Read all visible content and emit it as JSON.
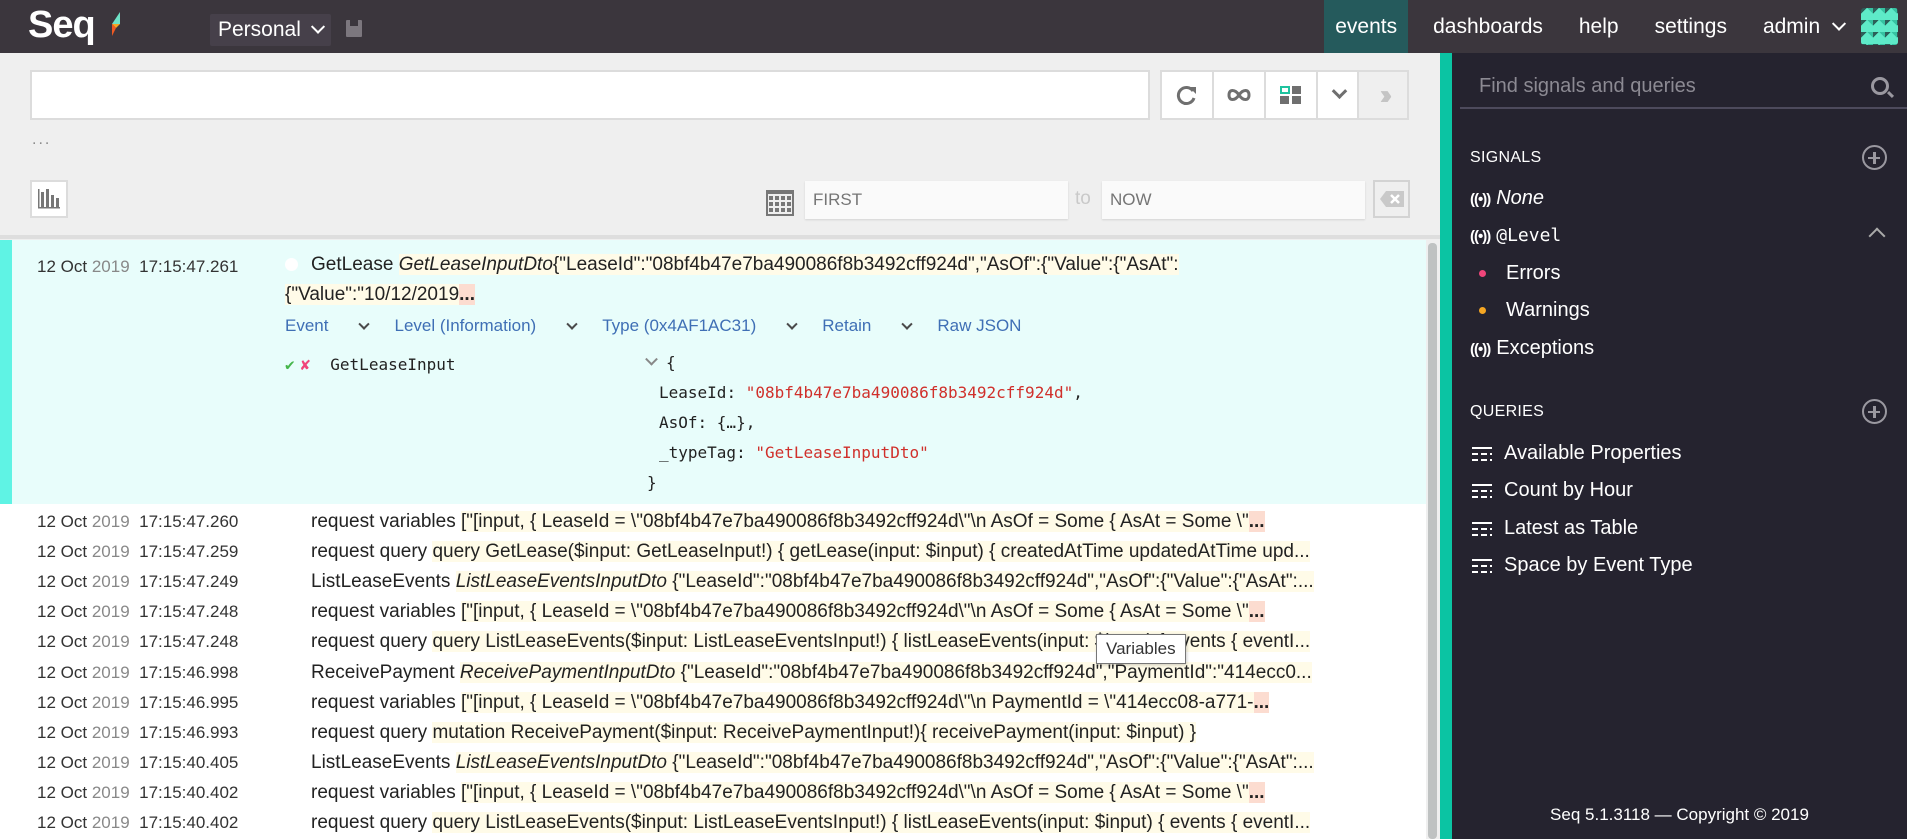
{
  "app": {
    "logo": "Seq",
    "workspace": "Personal"
  },
  "nav": {
    "items": [
      "events",
      "dashboards",
      "help",
      "settings"
    ],
    "active": "events",
    "user": "admin"
  },
  "search": {
    "value": "",
    "placeholder": "",
    "ellipsis": "..."
  },
  "toolbar": {
    "refresh_icon": "refresh-icon",
    "tail_icon": "infinity-icon",
    "layout_icon": "layout-grid-icon",
    "dropdown_icon": "chevron-down-icon",
    "expand_icon": "double-chevron-right-icon"
  },
  "date_range": {
    "from_placeholder": "FIRST",
    "to_label": "to",
    "to_placeholder": "NOW"
  },
  "selected_event": {
    "day_month": "12 Oct",
    "year": "2019",
    "time": "17:15:47.261",
    "name": "GetLease",
    "type": "GetLeaseInputDto",
    "payload_line1": "{\"LeaseId\":\"08bf4b47e7ba490086f8b3492cff924d\",\"AsOf\":{\"Value\":{\"AsAt\":",
    "payload_line2": "{\"Value\":\"10/12/2019",
    "more": "...",
    "actions": [
      {
        "label": "Event",
        "dropdown": true
      },
      {
        "label": "Level (Information)",
        "dropdown": true
      },
      {
        "label": "Type (0x4AF1AC31)",
        "dropdown": true
      },
      {
        "label": "Retain",
        "dropdown": true
      },
      {
        "label": "Raw JSON",
        "dropdown": false
      }
    ],
    "property": {
      "name": "GetLeaseInput",
      "open_brace": "{",
      "fields": [
        {
          "key": "LeaseId",
          "value": "\"08bf4b47e7ba490086f8b3492cff924d\"",
          "is_string": true,
          "suffix": ","
        },
        {
          "key": "AsOf",
          "value": "{…}",
          "is_string": false,
          "suffix": ","
        },
        {
          "key": "_typeTag",
          "value": "\"GetLeaseInputDto\"",
          "is_string": true,
          "suffix": ""
        }
      ],
      "close_brace": "}"
    }
  },
  "events": [
    {
      "day_month": "12 Oct",
      "year": "2019",
      "time": "17:15:47.260",
      "pre": "request variables ",
      "hl": "[\"[input, { LeaseId = \\\"08bf4b47e7ba490086f8b3492cff924d\\\"\\n AsOf = Some { AsAt = Some \\\"",
      "it": "",
      "post": "",
      "more": "..."
    },
    {
      "day_month": "12 Oct",
      "year": "2019",
      "time": "17:15:47.259",
      "pre": "request query ",
      "hl": "query GetLease($input: GetLeaseInput!) { getLease(input: $input) { createdAtTime updatedAtTime upd...",
      "it": "",
      "post": "",
      "more": ""
    },
    {
      "day_month": "12 Oct",
      "year": "2019",
      "time": "17:15:47.249",
      "pre": "ListLeaseEvents ",
      "it": "ListLeaseEventsInputDto",
      "hl": " {\"LeaseId\":\"08bf4b47e7ba490086f8b3492cff924d\",\"AsOf\":{\"Value\":{\"AsAt\":...",
      "post": "",
      "more": ""
    },
    {
      "day_month": "12 Oct",
      "year": "2019",
      "time": "17:15:47.248",
      "pre": "request variables ",
      "hl": "[\"[input, { LeaseId = \\\"08bf4b47e7ba490086f8b3492cff924d\\\"\\n AsOf = Some { AsAt = Some \\\"",
      "it": "",
      "post": "",
      "more": "..."
    },
    {
      "day_month": "12 Oct",
      "year": "2019",
      "time": "17:15:47.248",
      "pre": "request query ",
      "hl": "query ListLeaseEvents($input: ListLeaseEventsInput!) { listLeaseEvents(input: $input) { events { eventI...",
      "it": "",
      "post": "",
      "more": ""
    },
    {
      "day_month": "12 Oct",
      "year": "2019",
      "time": "17:15:46.998",
      "pre": "ReceivePayment ",
      "it": "ReceivePaymentInputDto",
      "hl": " {\"LeaseId\":\"08bf4b47e7ba490086f8b3492cff924d\",\"PaymentId\":\"414ecc0...",
      "post": "",
      "more": ""
    },
    {
      "day_month": "12 Oct",
      "year": "2019",
      "time": "17:15:46.995",
      "pre": "request variables ",
      "hl": "[\"[input, { LeaseId = \\\"08bf4b47e7ba490086f8b3492cff924d\\\"\\n PaymentId = \\\"414ecc08-a771-",
      "it": "",
      "post": "",
      "more": "..."
    },
    {
      "day_month": "12 Oct",
      "year": "2019",
      "time": "17:15:46.993",
      "pre": "request query ",
      "hl": "mutation ReceivePayment($input: ReceivePaymentInput!){ receivePayment(input: $input) }",
      "it": "",
      "post": "",
      "more": ""
    },
    {
      "day_month": "12 Oct",
      "year": "2019",
      "time": "17:15:40.405",
      "pre": "ListLeaseEvents ",
      "it": "ListLeaseEventsInputDto",
      "hl": " {\"LeaseId\":\"08bf4b47e7ba490086f8b3492cff924d\",\"AsOf\":{\"Value\":{\"AsAt\":...",
      "post": "",
      "more": ""
    },
    {
      "day_month": "12 Oct",
      "year": "2019",
      "time": "17:15:40.402",
      "pre": "request variables ",
      "hl": "[\"[input, { LeaseId = \\\"08bf4b47e7ba490086f8b3492cff924d\\\"\\n AsOf = Some { AsAt = Some \\\"",
      "it": "",
      "post": "",
      "more": "..."
    },
    {
      "day_month": "12 Oct",
      "year": "2019",
      "time": "17:15:40.402",
      "pre": "request query ",
      "hl": "query ListLeaseEvents($input: ListLeaseEventsInput!) { listLeaseEvents(input: $input) { events { eventI...",
      "it": "",
      "post": "",
      "more": ""
    }
  ],
  "tooltip": "Variables",
  "sidebar": {
    "search_placeholder": "Find signals and queries",
    "signals_title": "SIGNALS",
    "signals": [
      {
        "label": "None",
        "style": "italic"
      },
      {
        "label": "@Level",
        "style": "mono",
        "expanded": true
      },
      {
        "label": "Exceptions",
        "style": "normal"
      }
    ],
    "level_children": [
      {
        "label": "Errors",
        "color": "#f0457a"
      },
      {
        "label": "Warnings",
        "color": "#f5a623"
      }
    ],
    "queries_title": "QUERIES",
    "queries": [
      "Available Properties",
      "Count by Hour",
      "Latest as Table",
      "Space by Event Type"
    ],
    "footer": "Seq 5.1.3118 — Copyright © 2019"
  },
  "colors": {
    "topbar": "#3b363d",
    "active_nav": "#255a5c",
    "accent": "#0bc4a3",
    "selected_row": "#e8fdfb",
    "selected_marker": "#5ff3e4",
    "sidebar": "#25232f",
    "link": "#3f6fb5",
    "json_string": "#d0302b"
  }
}
